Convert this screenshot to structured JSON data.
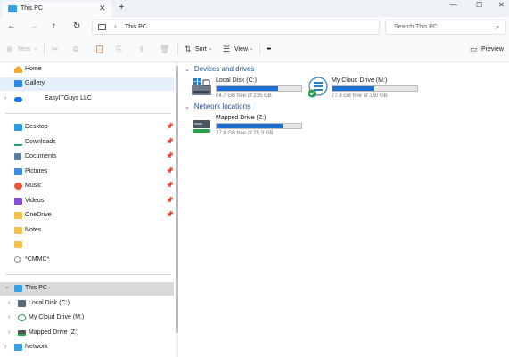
{
  "window": {
    "tab_title": "This PC",
    "tab_close": "✕",
    "new_tab": "+",
    "controls": [
      "—",
      "☐",
      "✕"
    ]
  },
  "navbar": {
    "back": "←",
    "forward": "→",
    "up": "↑",
    "refresh": "↻",
    "separator": "›",
    "breadcrumb": "This PC",
    "search_placeholder": "Search This PC",
    "search_icon": "⌕"
  },
  "command_bar": {
    "new_label": "New",
    "sort_label": "Sort",
    "view_label": "View",
    "more_label": "•••",
    "preview_label": "Preview",
    "dropdown_chevron": "⌄",
    "icons": {
      "new": "⊕",
      "cut": "✂",
      "copy": "⧉",
      "paste": "📋",
      "rename": "⎘",
      "share": "⇪",
      "delete": "🗑",
      "sort": "⇅",
      "view": "☰",
      "preview": "▭"
    }
  },
  "sidebar": {
    "top_items": [
      {
        "label": "Home",
        "icon": "home-icon",
        "color": "#f0a830"
      },
      {
        "label": "Gallery",
        "icon": "gallery-icon",
        "color": "#2f8ae0",
        "selected": true
      },
      {
        "label": "EasyITGuys LLC",
        "icon": "onedrive-cloud-icon",
        "color": "#1a73e8"
      }
    ],
    "quick_access": [
      {
        "label": "Desktop",
        "icon": "desktop-icon",
        "color": "#2b9be0"
      },
      {
        "label": "Downloads",
        "icon": "downloads-icon",
        "color": "#1f9a6a"
      },
      {
        "label": "Documents",
        "icon": "documents-icon",
        "color": "#5a7fa8"
      },
      {
        "label": "Pictures",
        "icon": "pictures-icon",
        "color": "#3c8ee0"
      },
      {
        "label": "Music",
        "icon": "music-icon",
        "color": "#e25a3a"
      },
      {
        "label": "Videos",
        "icon": "videos-icon",
        "color": "#8a4fd8"
      },
      {
        "label": "OneDrive",
        "icon": "folder-icon",
        "color": "#f2c14e"
      },
      {
        "label": "Notes",
        "icon": "folder-icon",
        "color": "#f2c14e"
      },
      {
        "label": "",
        "icon": "folder-icon",
        "color": "#f2c14e"
      },
      {
        "label": "*CMMC*",
        "icon": "search-folder-icon",
        "color": "#8b8b8b"
      }
    ],
    "pin_glyph": "📌",
    "this_pc": {
      "label": "This PC",
      "icon": "this-pc-icon",
      "color": "#3aa0e6"
    },
    "drives": [
      {
        "label": "Local Disk (C:)",
        "icon": "disk-icon",
        "color": "#5a6b7c"
      },
      {
        "label": "My Cloud Drive (M:)",
        "icon": "cloud-drive-icon",
        "color": "#2aa04a"
      },
      {
        "label": "Mapped Drive (Z:)",
        "icon": "network-drive-icon",
        "color": "#2aa04a"
      }
    ],
    "network": {
      "label": "Network",
      "icon": "network-icon",
      "color": "#3aa0e6"
    },
    "chev_right": "›",
    "chev_down": "⌄"
  },
  "content": {
    "devices_heading": "Devices and drives",
    "network_heading": "Network locations",
    "chevron": "⌄",
    "devices": [
      {
        "name": "Local Disk (C:)",
        "free": "64.7 GB free of 235 GB",
        "used_fraction": 0.725,
        "icon": "windows-disk-icon"
      },
      {
        "name": "My Cloud Drive (M:)",
        "free": "77.8 GB free of 150 GB",
        "used_fraction": 0.481,
        "icon": "cloud-drive-icon"
      }
    ],
    "network_locations": [
      {
        "name": "Mapped Drive (Z:)",
        "free": "17.8 GB free of 79.3 GB",
        "used_fraction": 0.776,
        "icon": "network-drive-icon"
      }
    ]
  }
}
